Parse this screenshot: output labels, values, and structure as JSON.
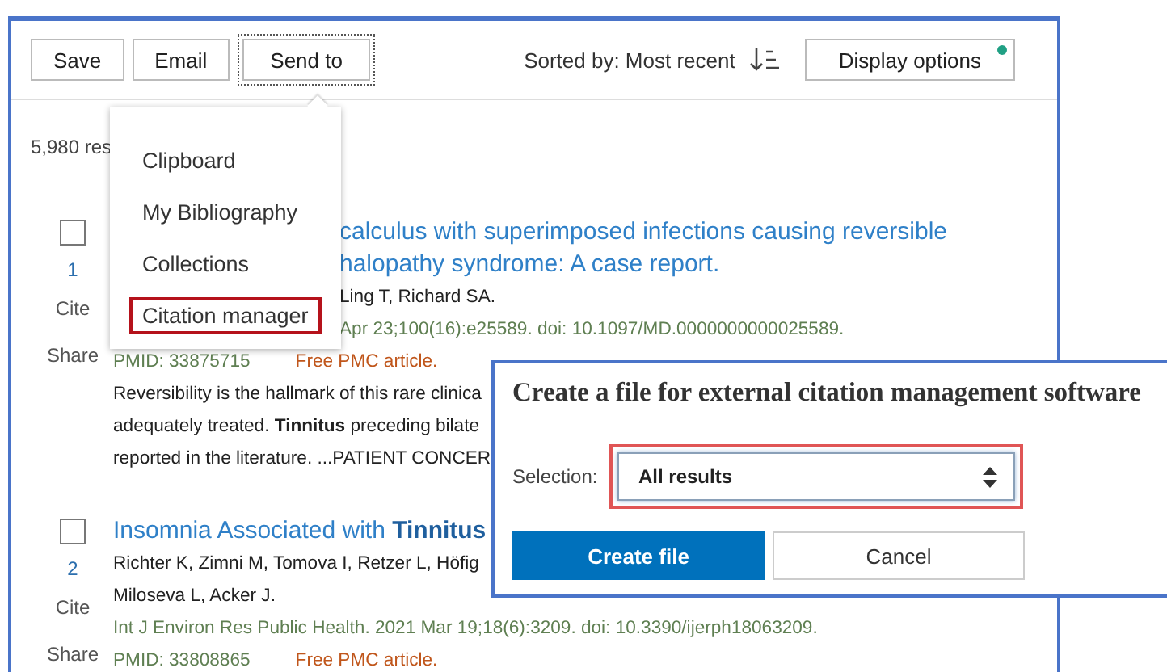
{
  "toolbar": {
    "buttons": [
      {
        "label": "Save",
        "focused": false
      },
      {
        "label": "Email",
        "focused": false
      },
      {
        "label": "Send to",
        "focused": true
      }
    ],
    "sort_label": "Sorted by: Most recent",
    "display_options": {
      "label": "Display options",
      "indicator": true
    }
  },
  "results_count": "5,980 res",
  "results": [
    {
      "number": "1",
      "checked": false,
      "cite": "Cite",
      "share": "Share",
      "title_lines": [
        "calculus with superimposed infections causing reversible",
        "halopathy syndrome: A case report."
      ],
      "title_visible_from_start": false,
      "authors": [
        "Ling T, Richard SA."
      ],
      "journal": "Apr 23;100(16):e25589. doi: 10.1097/MD.0000000000025589.",
      "pmid": "PMID: 33875715",
      "free_pmc": "Free PMC article.",
      "snippet": [
        "Reversibility is the hallmark of this rare clinica",
        "adequately treated. **Tinnitus** preceding bilate",
        "reported in the literature. ...PATIENT CONCER"
      ]
    },
    {
      "number": "2",
      "checked": false,
      "cite": "Cite",
      "share": "Share",
      "title_lines": [
        "Insomnia Associated with **Tinnitus**"
      ],
      "title_visible_from_start": true,
      "authors": [
        "Richter K, Zimni M, Tomova I, Retzer L, Höfig",
        "Miloseva L, Acker J."
      ],
      "journal": "Int J Environ Res Public Health. 2021 Mar 19;18(6):3209. doi: 10.3390/ijerph18063209.",
      "pmid": "PMID: 33808865",
      "free_pmc": "Free PMC article."
    }
  ],
  "send_to_menu": {
    "items": [
      {
        "label": "Clipboard",
        "highlighted": false
      },
      {
        "label": "My Bibliography",
        "highlighted": false
      },
      {
        "label": "Collections",
        "highlighted": false
      },
      {
        "label": "Citation manager",
        "highlighted": true
      }
    ]
  },
  "citation_dialog": {
    "title": "Create a file for external citation management software",
    "selection_label": "Selection:",
    "selection_value": "All results",
    "selection_highlighted": true,
    "buttons": [
      {
        "label": "Create file",
        "kind": "primary"
      },
      {
        "label": "Cancel",
        "kind": "secondary"
      }
    ]
  }
}
